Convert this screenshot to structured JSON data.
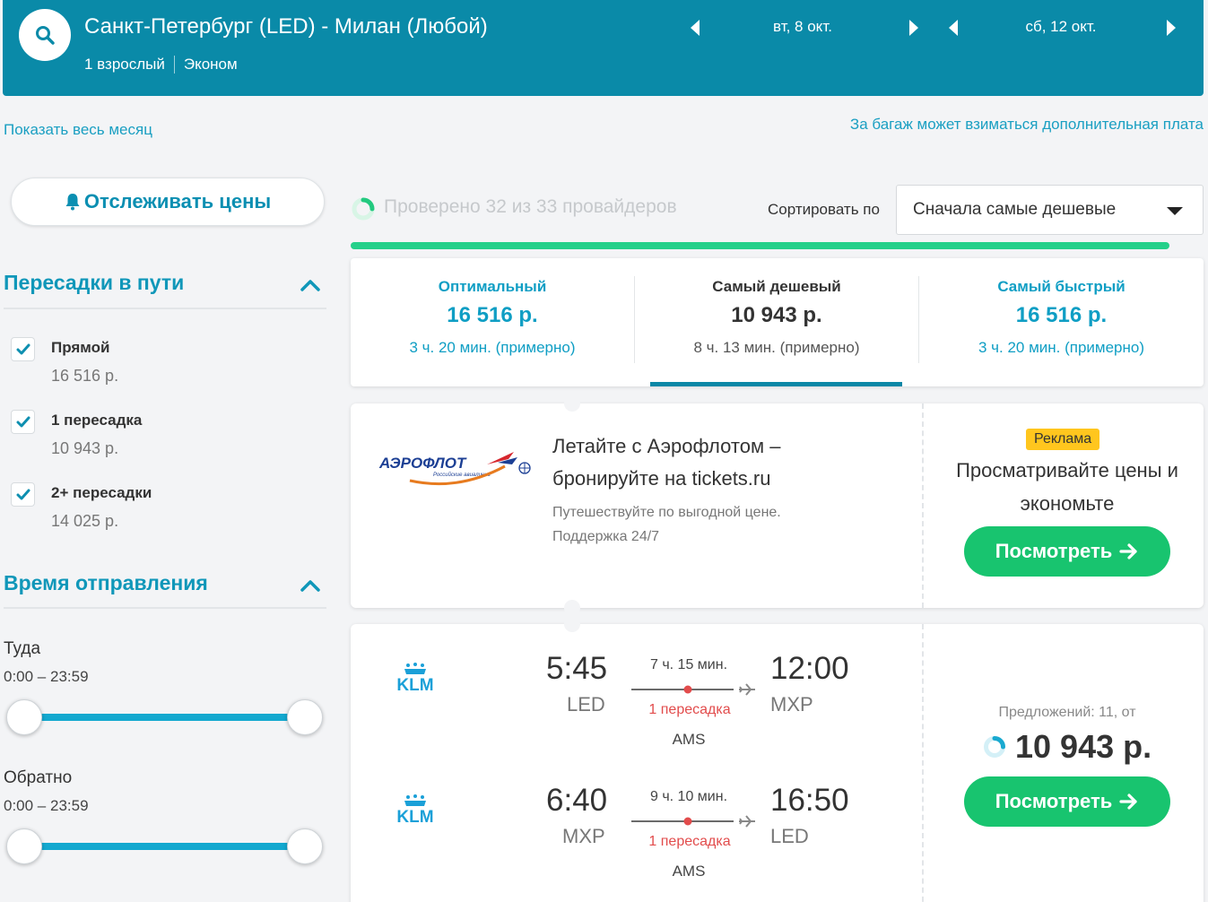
{
  "header": {
    "route": "Санкт-Петербург (LED) - Милан (Любой)",
    "passengers": "1 взрослый",
    "cabin_class": "Эконом",
    "depart_date": "вт, 8 окт.",
    "return_date": "сб, 12 окт."
  },
  "links": {
    "show_month": "Показать весь месяц",
    "baggage_note": "За багаж может взиматься дополнительная плата"
  },
  "sidebar": {
    "track_prices": "Отслеживать цены",
    "stops_title": "Пересадки в пути",
    "stops": [
      {
        "label": "Прямой",
        "price": "16 516 р.",
        "checked": true
      },
      {
        "label": "1 пересадка",
        "price": "10 943 р.",
        "checked": true
      },
      {
        "label": "2+ пересадки",
        "price": "14 025 р.",
        "checked": true
      }
    ],
    "departure_title": "Время отправления",
    "outbound_label": "Туда",
    "outbound_range": "0:00 – 23:59",
    "return_label": "Обратно",
    "return_range": "0:00 – 23:59"
  },
  "toolbar": {
    "providers_status": "Проверено 32 из 33 провайдеров",
    "sort_label": "Сортировать по",
    "sort_value": "Сначала самые дешевые",
    "search_progress": 0.96
  },
  "tabs": [
    {
      "label": "Оптимальный",
      "price": "16 516 р.",
      "duration": "3 ч. 20 мин. (примерно)"
    },
    {
      "label": "Самый дешевый",
      "price": "10 943 р.",
      "duration": "8 ч. 13 мин. (примерно)",
      "selected": true
    },
    {
      "label": "Самый быстрый",
      "price": "16 516 р.",
      "duration": "3 ч. 20 мин. (примерно)"
    }
  ],
  "ad": {
    "logo_text": "АЭРОФЛОТ",
    "logo_subtext": "Российские авиалинии",
    "title": "Летайте с Аэрофлотом – бронируйте на tickets.ru",
    "subtitle": "Путешествуйте по выгодной цене. Поддержка 24/7",
    "badge": "Реклама",
    "promo_text": "Просматривайте цены и экономьте",
    "button": "Посмотреть"
  },
  "result": {
    "airline": "KLM",
    "outbound": {
      "dep_time": "5:45",
      "dep_code": "LED",
      "duration": "7 ч. 15 мин.",
      "stops": "1 пересадка",
      "via": "AMS",
      "arr_time": "12:00",
      "arr_code": "MXP"
    },
    "inbound": {
      "dep_time": "6:40",
      "dep_code": "MXP",
      "duration": "9 ч. 10 мин.",
      "stops": "1 пересадка",
      "via": "AMS",
      "arr_time": "16:50",
      "arr_code": "LED"
    },
    "offers": "Предложений: 11, от",
    "price": "10 943 р.",
    "button": "Посмотреть"
  },
  "colors": {
    "brand": "#0a8aa8",
    "accent": "#1097b9",
    "cta_green": "#18c46f",
    "progress_green": "#24d08a",
    "stops_red": "#e24c4c",
    "ad_badge": "#ffc61e"
  }
}
